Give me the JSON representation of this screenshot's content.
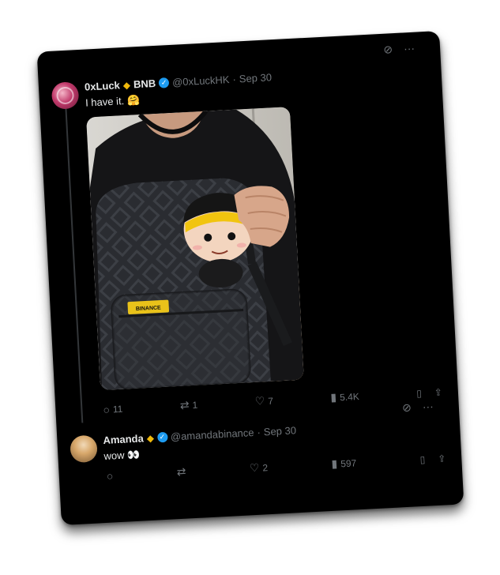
{
  "post1": {
    "author": "0xLuck",
    "suffix": "BNB",
    "handle": "@0xLuckHK",
    "date": "Sep 30",
    "text": "I have it. 🤗",
    "actions": {
      "reply": "",
      "reply_icon": "reply-icon",
      "retweet": "1",
      "like": "7",
      "views": "5.4K"
    }
  },
  "photo": {
    "patch_label": "BINANCE"
  },
  "post2": {
    "author": "Amanda",
    "handle": "@amandabinance",
    "date": "Sep 30",
    "text": "wow 👀",
    "actions": {
      "reply": "",
      "retweet": "",
      "like": "2",
      "views": "597"
    }
  },
  "post1_reply_count": "11",
  "colors": {
    "background": "#000000",
    "text": "#e7e9ea",
    "muted": "#71767b",
    "verified": "#1d9bf0",
    "bnb": "#f0b90b"
  }
}
